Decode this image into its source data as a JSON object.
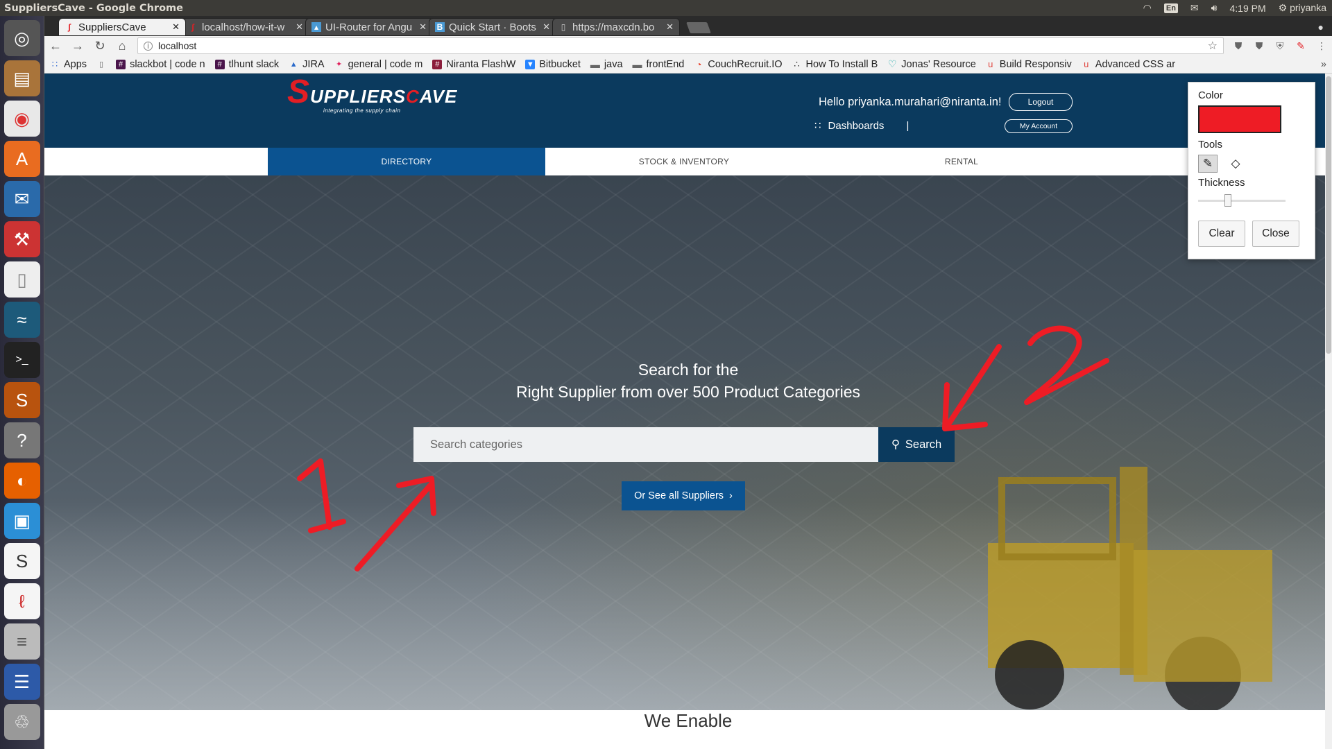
{
  "os": {
    "window_title": "SuppliersCave - Google Chrome",
    "lang": "En",
    "time": "4:19 PM",
    "user": "priyanka"
  },
  "browser": {
    "tabs": [
      {
        "label": "SuppliersCave",
        "icon": "suppliers-favicon"
      },
      {
        "label": "localhost/how-it-w",
        "icon": "suppliers-favicon"
      },
      {
        "label": "UI-Router for Angu",
        "icon": "ui-router-favicon"
      },
      {
        "label": "Quick Start · Boots",
        "icon": "bootstrap-favicon"
      },
      {
        "label": "https://maxcdn.bo",
        "icon": "page-icon"
      }
    ],
    "url": "localhost",
    "bookmarks": [
      {
        "label": "Apps",
        "icon": "apps-grid-icon"
      },
      {
        "label": "",
        "icon": "page-icon"
      },
      {
        "label": "slackbot | code n",
        "icon": "slack-icon"
      },
      {
        "label": "tlhunt slack",
        "icon": "slack-icon"
      },
      {
        "label": "JIRA",
        "icon": "jira-icon"
      },
      {
        "label": "general | code m",
        "icon": "slack-icon"
      },
      {
        "label": "Niranta FlashW",
        "icon": "slack-icon"
      },
      {
        "label": "Bitbucket",
        "icon": "bitbucket-icon"
      },
      {
        "label": "java",
        "icon": "folder-icon"
      },
      {
        "label": "frontEnd",
        "icon": "folder-icon"
      },
      {
        "label": "CouchRecruit.IO",
        "icon": "couch-icon"
      },
      {
        "label": "How To Install B",
        "icon": "flame-icon"
      },
      {
        "label": "Jonas' Resource",
        "icon": "heart-icon"
      },
      {
        "label": "Build Responsiv",
        "icon": "udemy-icon"
      },
      {
        "label": "Advanced CSS ar",
        "icon": "udemy-icon"
      }
    ]
  },
  "site": {
    "logo_s": "S",
    "logo_text": "UPPLIERS",
    "logo_c": "C",
    "logo_text2": "AVE",
    "logo_tagline": "integrating the supply chain",
    "hello": "Hello priyanka.murahari@niranta.in!",
    "logout": "Logout",
    "dashboards": "Dashboards",
    "separator": "|",
    "my_account": "My Account",
    "nav": [
      {
        "label": "DIRECTORY",
        "active": true
      },
      {
        "label": "STOCK & INVENTORY",
        "active": false
      },
      {
        "label": "RENTAL",
        "active": false
      }
    ],
    "hero_line1": "Search for the",
    "hero_line2": "Right Supplier from over 500 Product Categories",
    "search_placeholder": "Search categories",
    "search_button": "Search",
    "see_all": "Or See all Suppliers",
    "below_heading": "We Enable"
  },
  "annotations": {
    "label1": "1",
    "label2": "2",
    "color": "#ee1c25"
  },
  "draw_panel": {
    "color_label": "Color",
    "color_value": "#ee1c25",
    "tools_label": "Tools",
    "thickness_label": "Thickness",
    "thickness_level": 0.33,
    "clear": "Clear",
    "close": "Close"
  }
}
